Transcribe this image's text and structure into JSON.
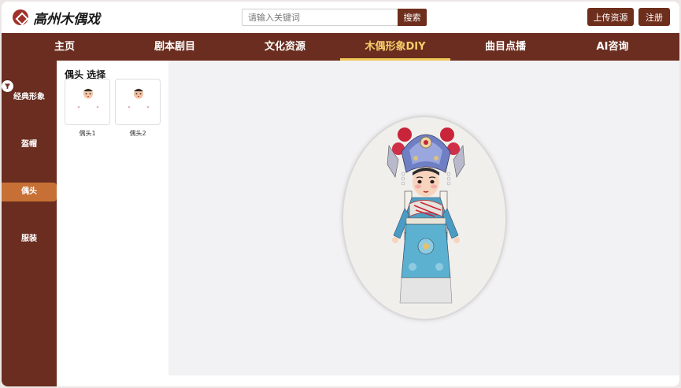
{
  "brand": {
    "name": "高州木偶戏"
  },
  "search": {
    "placeholder": "请输入关键词",
    "button_label": "搜索"
  },
  "header": {
    "upload_label": "上传资源",
    "register_label": "注册"
  },
  "nav": {
    "items": [
      {
        "label": "主页"
      },
      {
        "label": "剧本剧目"
      },
      {
        "label": "文化资源"
      },
      {
        "label": "木偶形象DIY"
      },
      {
        "label": "曲目点播"
      },
      {
        "label": "AI咨询"
      }
    ],
    "active": "木偶形象DIY"
  },
  "categories": {
    "items": [
      {
        "label": "经典形象"
      },
      {
        "label": "盔帽"
      },
      {
        "label": "偶头"
      },
      {
        "label": "服装"
      }
    ],
    "active": "偶头"
  },
  "selector": {
    "title": "偶头 选择",
    "options": [
      {
        "label": "偶头1"
      },
      {
        "label": "偶头2"
      }
    ]
  },
  "colors": {
    "brand_brown": "#6a2d1f",
    "active_category": "#c77035",
    "active_nav": "#f5cf6a"
  }
}
